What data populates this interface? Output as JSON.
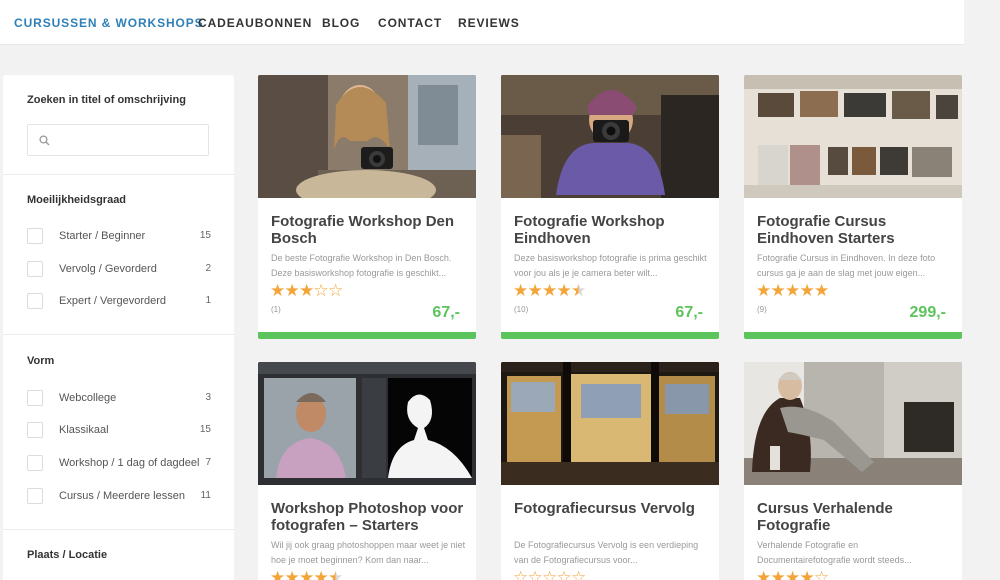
{
  "nav": {
    "items": [
      "CURSUSSEN & WORKSHOPS",
      "CADEAUBONNEN",
      "BLOG",
      "CONTACT",
      "REVIEWS"
    ],
    "active_color": "#2f7fb8"
  },
  "sidebar": {
    "search_title": "Zoeken in titel of omschrijving",
    "search_placeholder": "",
    "groups": [
      {
        "title": "Moeilijkheidsgraad",
        "options": [
          {
            "label": "Starter / Beginner",
            "count": "15"
          },
          {
            "label": "Vervolg / Gevorderd",
            "count": "2"
          },
          {
            "label": "Expert / Vergevorderd",
            "count": "1"
          }
        ]
      },
      {
        "title": "Vorm",
        "options": [
          {
            "label": "Webcollege",
            "count": "3"
          },
          {
            "label": "Klassikaal",
            "count": "15"
          },
          {
            "label": "Workshop / 1 dag of dagdeel",
            "count": "7"
          },
          {
            "label": "Cursus / Meerdere lessen",
            "count": "11"
          }
        ]
      },
      {
        "title": "Plaats / Locatie",
        "options": []
      }
    ]
  },
  "cards": [
    {
      "title": "Fotografie Workshop Den Bosch",
      "description": "De beste Fotografie Workshop in Den Bosch. Deze basisworkshop fotografie is geschikt...",
      "rating": 3,
      "reviews": "(1)",
      "price": "67,-"
    },
    {
      "title": "Fotografie Workshop Eindhoven",
      "description": "Deze basisworkshop fotografie is prima geschikt voor jou als je je camera beter wilt...",
      "rating": 4.5,
      "reviews": "(10)",
      "price": "67,-"
    },
    {
      "title": "Fotografie Cursus Eindhoven Starters",
      "description": "Fotografie Cursus in Eindhoven. In deze foto cursus ga je aan de slag met jouw eigen...",
      "rating": 5,
      "reviews": "(9)",
      "price": "299,-"
    },
    {
      "title": "Workshop Photoshop voor fotografen – Starters",
      "description": "Wil jij ook graag photoshoppen maar weet je niet hoe je moet beginnen? Kom dan naar...",
      "rating": 4.5,
      "reviews": "",
      "price": ""
    },
    {
      "title": "Fotografiecursus Vervolg",
      "description": "De Fotografiecursus Vervolg is een verdieping van de Fotografiecursus voor...",
      "rating": 0,
      "reviews": "",
      "price": ""
    },
    {
      "title": "Cursus Verhalende Fotografie",
      "description": "Verhalende Fotografie en Documentairefotografie wordt steeds...",
      "rating": 4,
      "reviews": "",
      "price": ""
    }
  ],
  "colors": {
    "price_green": "#5cc45c",
    "star_orange": "#f3a53a",
    "background": "#f2f2f2"
  }
}
